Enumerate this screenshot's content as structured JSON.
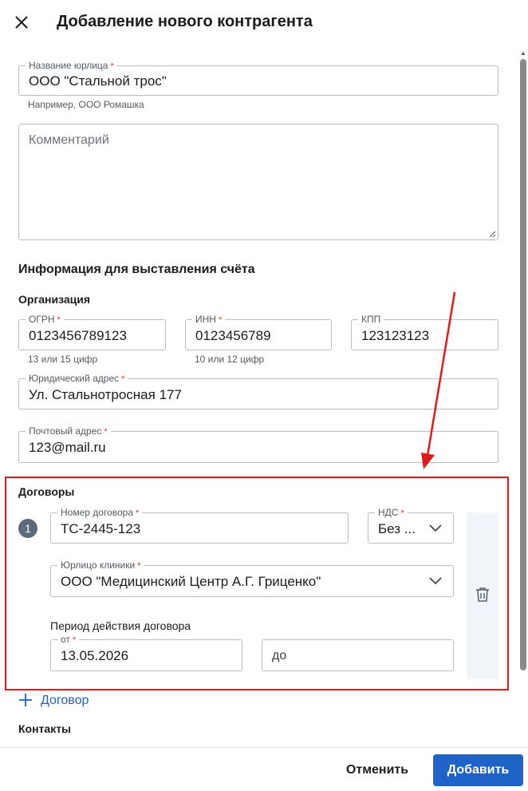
{
  "header": {
    "title": "Добавление нового контрагента"
  },
  "legal_name": {
    "label": "Название юрлица",
    "value": "ООО \"Стальной трос\"",
    "hint": "Например, ООО Ромашка"
  },
  "comment": {
    "placeholder": "Комментарий"
  },
  "billing": {
    "title": "Информация для выставления счёта",
    "organization_title": "Организация",
    "ogrn": {
      "label": "ОГРН",
      "value": "0123456789123",
      "hint": "13 или 15 цифр"
    },
    "inn": {
      "label": "ИНН",
      "value": "0123456789",
      "hint": "10 или 12 цифр"
    },
    "kpp": {
      "label": "КПП",
      "value": "123123123"
    },
    "legal_address": {
      "label": "Юридический адрес",
      "value": "Ул. Стальнотросная 177"
    },
    "postal_address": {
      "label": "Почтовый адрес",
      "value": "123@mail.ru"
    }
  },
  "contracts": {
    "title": "Договоры",
    "items": [
      {
        "index": "1",
        "number": {
          "label": "Номер договора",
          "value": "ТС-2445-123"
        },
        "vat": {
          "label": "НДС",
          "value": "Без ..."
        },
        "clinic": {
          "label": "Юрлицо клиники",
          "value": "ООО \"Медицинский Центр А.Г. Гриценко\""
        },
        "period_label": "Период действия договора",
        "from": {
          "label": "от",
          "value": "13.05.2026"
        },
        "to": {
          "placeholder": "до"
        }
      }
    ],
    "add_label": "Договор"
  },
  "contacts": {
    "title": "Контакты"
  },
  "footer": {
    "cancel_label": "Отменить",
    "submit_label": "Добавить"
  },
  "colors": {
    "accent": "#1f63c6",
    "required": "#d0392f",
    "annotation": "#e01b1b"
  },
  "icons": [
    "close-icon",
    "chevron-down-icon",
    "trash-icon",
    "plus-icon"
  ]
}
